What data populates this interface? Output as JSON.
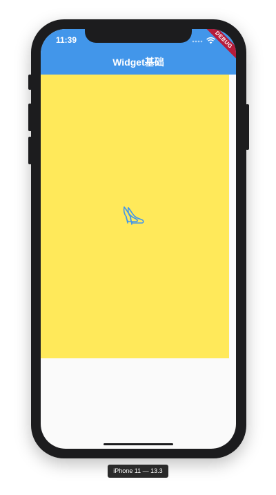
{
  "status_bar": {
    "time": "11:39"
  },
  "debug_banner": {
    "label": "DEBUG"
  },
  "app_bar": {
    "title": "Widget基础"
  },
  "content": {
    "icon": "high-heels-icon",
    "box_color": "#ffe95a",
    "icon_color": "#4296ea"
  },
  "theme": {
    "app_bar_color": "#4296ea",
    "background": "#fafafa"
  },
  "device": {
    "label": "iPhone 11 — 13.3"
  }
}
